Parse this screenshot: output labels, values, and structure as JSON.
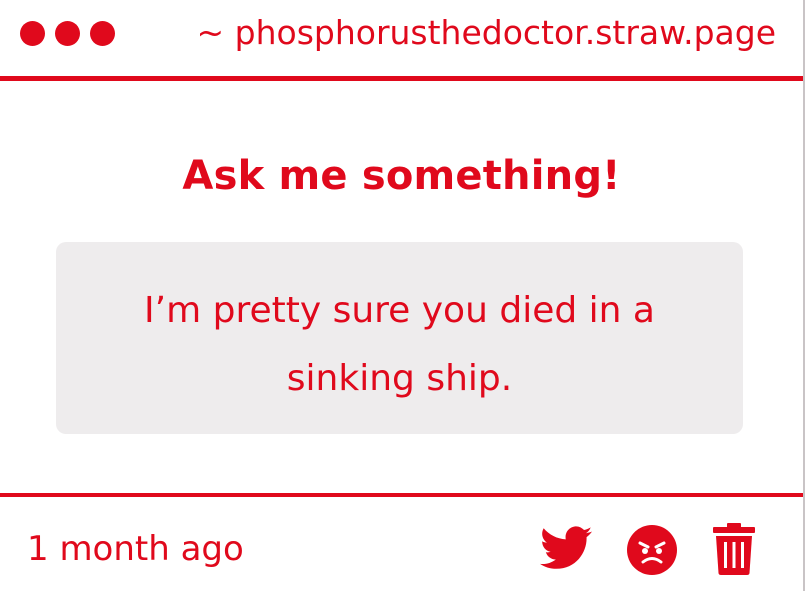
{
  "header": {
    "url": "~ phosphorusthedoctor.straw.page",
    "window_dots": [
      "red-dot",
      "red-dot",
      "red-dot"
    ]
  },
  "prompt": {
    "title": "Ask me something!"
  },
  "question": {
    "text": "I’m pretty sure you died in a sinking ship."
  },
  "footer": {
    "timestamp": "1 month ago",
    "actions": [
      {
        "icon": "twitter-icon"
      },
      {
        "icon": "angry-face-icon"
      },
      {
        "icon": "trash-icon"
      }
    ]
  },
  "colors": {
    "accent": "#e0091c",
    "bubble_bg": "#eeeced",
    "background": "#ffffff"
  }
}
